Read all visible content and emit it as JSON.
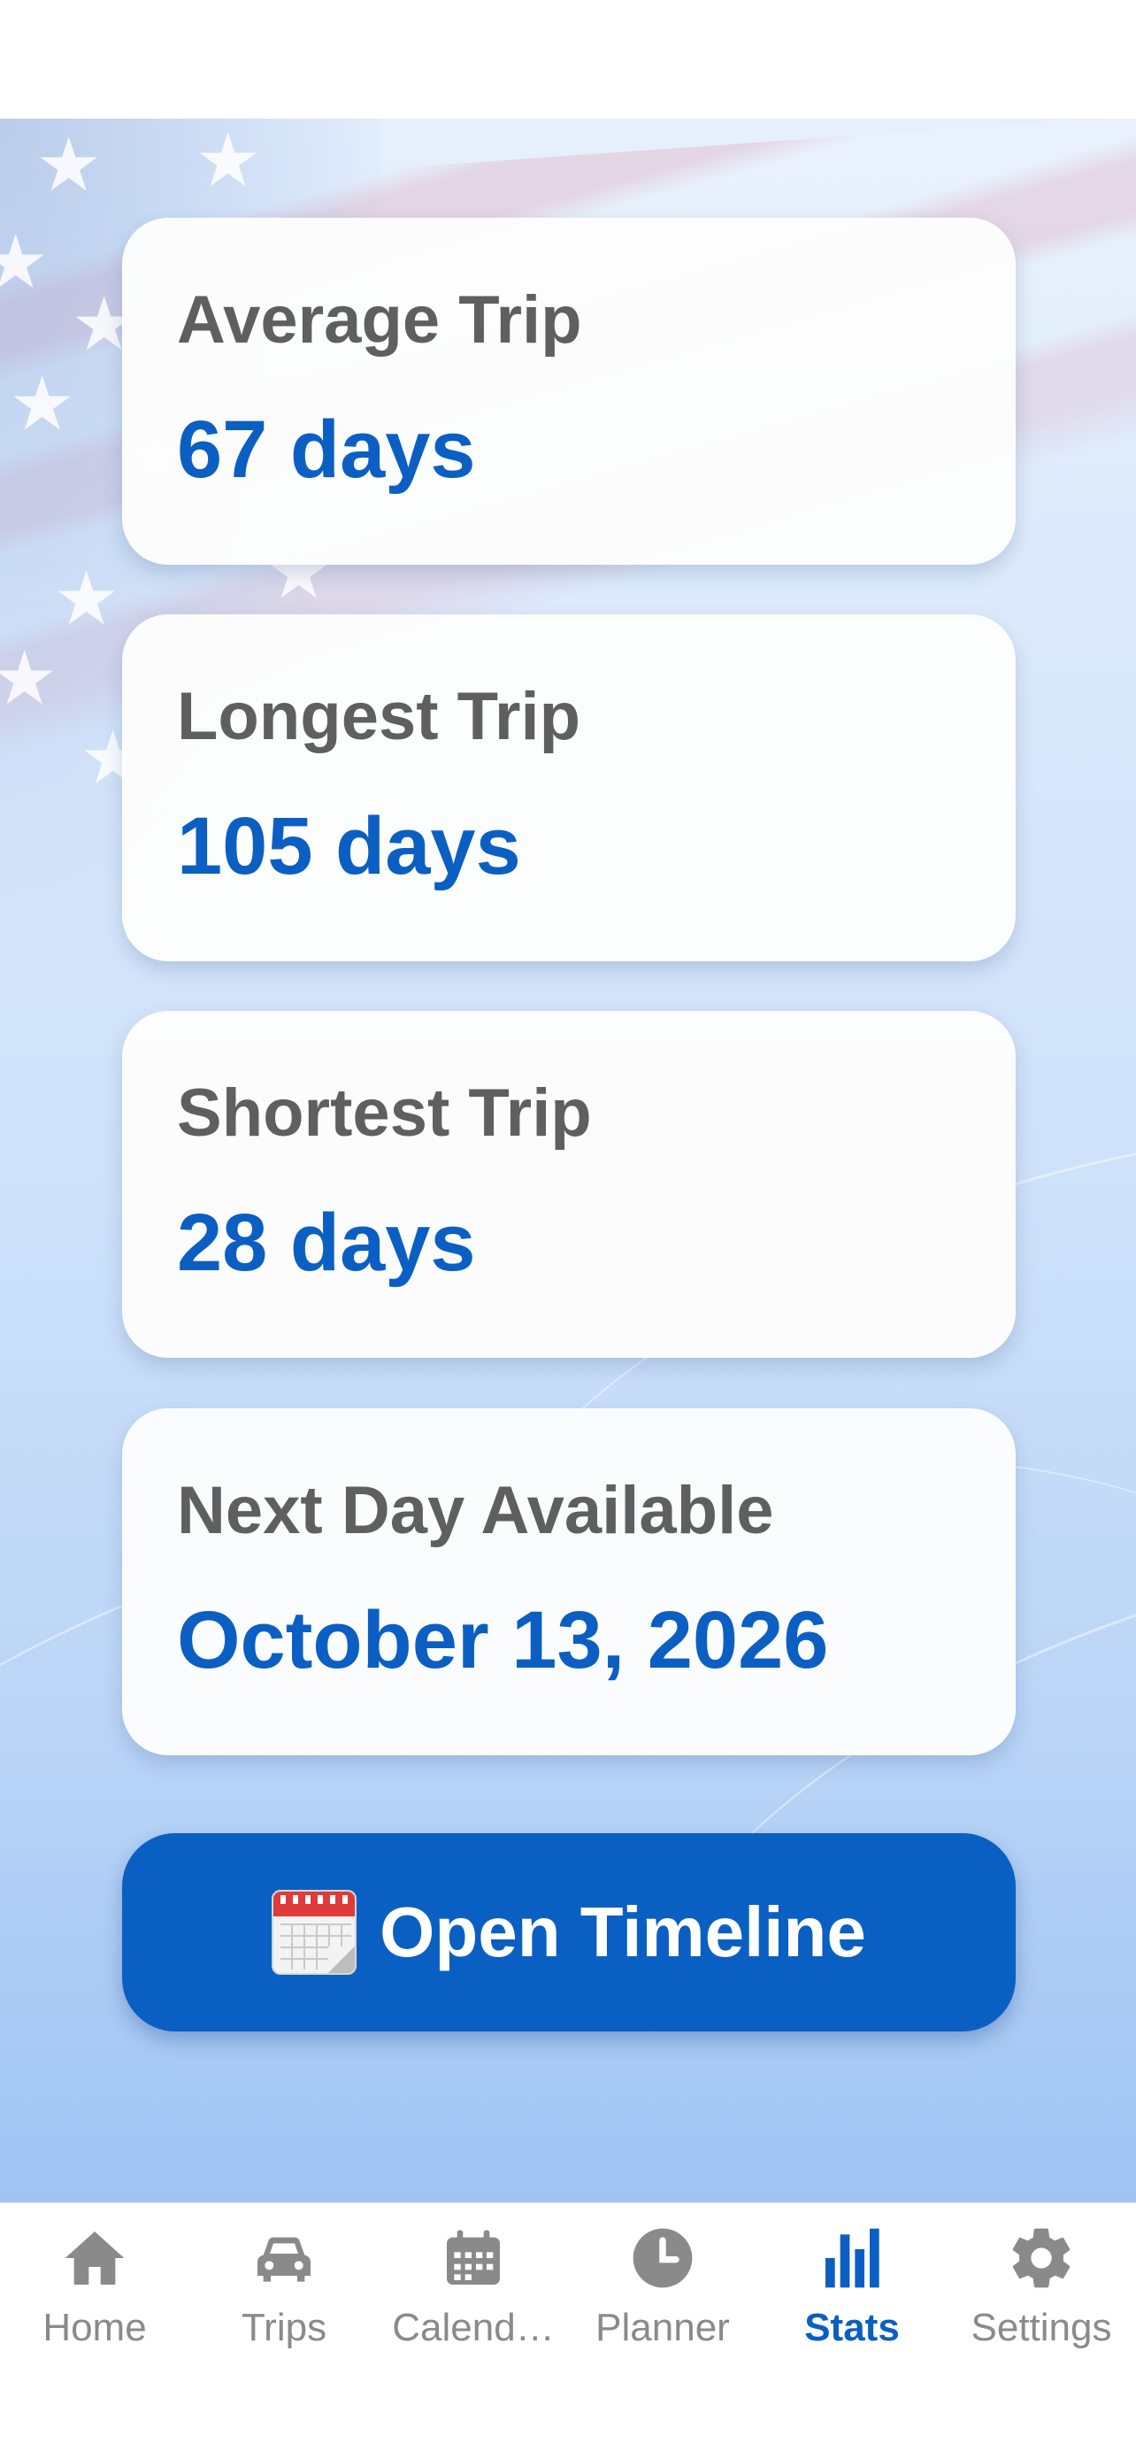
{
  "stats": {
    "cards": [
      {
        "label": "Average Trip",
        "value": "67 days"
      },
      {
        "label": "Longest Trip",
        "value": "105 days"
      },
      {
        "label": "Shortest Trip",
        "value": "28 days"
      },
      {
        "label": "Next Day Available",
        "value": "October 13, 2026"
      }
    ],
    "open_timeline_button": {
      "label": "Open Timeline",
      "icon": "calendar-emoji-icon"
    }
  },
  "tabbar": {
    "active_tab": "Stats",
    "tabs": [
      {
        "label": "Home",
        "icon": "home-icon"
      },
      {
        "label": "Trips",
        "icon": "car-icon"
      },
      {
        "label": "Calend…",
        "icon": "calendar-icon"
      },
      {
        "label": "Planner",
        "icon": "clock-icon"
      },
      {
        "label": "Stats",
        "icon": "bar-chart-icon"
      },
      {
        "label": "Settings",
        "icon": "gear-icon"
      }
    ]
  },
  "colors": {
    "accent": "#0a5fc2",
    "value_text": "#0b5fc3",
    "label_text": "#5f5f5f",
    "inactive_tab": "#8a8a8a"
  }
}
